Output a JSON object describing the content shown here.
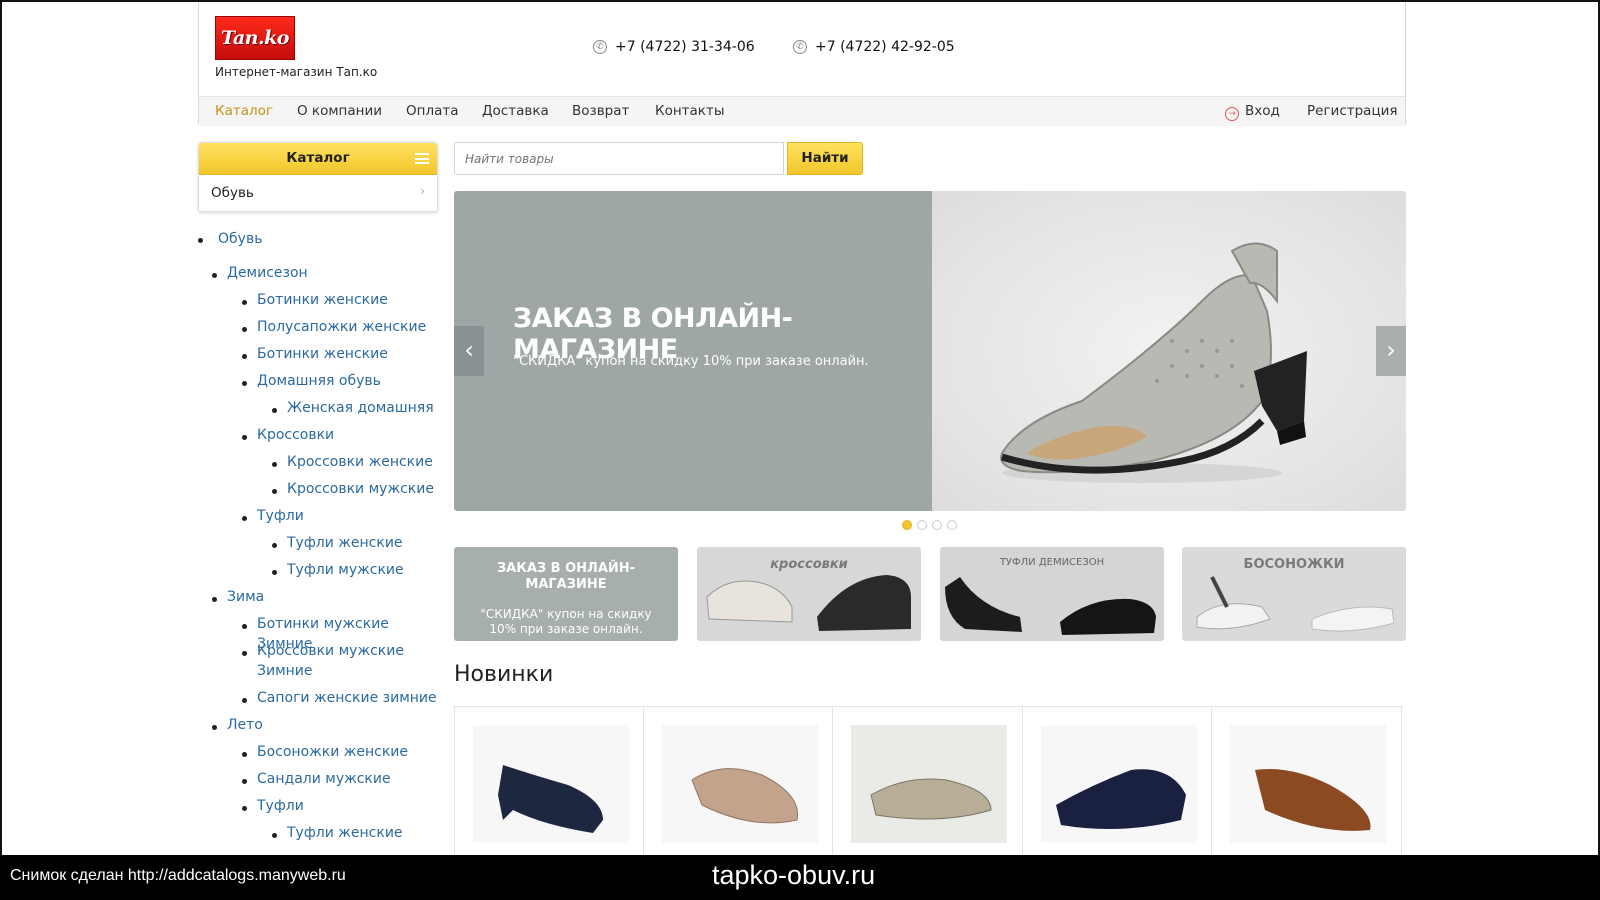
{
  "header": {
    "logo_text": "Tan.ko",
    "logo_subtitle": "Интернет-магазин Тап.ко",
    "phones": [
      "+7 (4722) 31-34-06",
      "+7 (4722) 42-92-05"
    ]
  },
  "nav": {
    "items": [
      "Каталог",
      "О компании",
      "Оплата",
      "Доставка",
      "Возврат",
      "Контакты"
    ],
    "login": "Вход",
    "register": "Регистрация"
  },
  "catalog": {
    "title": "Каталог",
    "row": "Обувь"
  },
  "tree": {
    "root": "Обувь",
    "demiseason": "Демисезон",
    "d1": "Ботинки женские",
    "d2": "Полусапожки женские",
    "d3": "Ботинки женские",
    "d4": "Домашняя обувь",
    "d4a": "Женская домашняя",
    "d5": "Кроссовки",
    "d5a": "Кроссовки женские",
    "d5b": "Кроссовки мужские",
    "d6": "Туфли",
    "d6a": "Туфли женские",
    "d6b": "Туфли мужские",
    "winter": "Зима",
    "w1": "Ботинки мужские Зимние",
    "w2": "Кроссовки мужские Зимние",
    "w3": "Сапоги женские зимние",
    "summer": "Лето",
    "s1": "Босоножки женские",
    "s2": "Сандали мужские",
    "s3": "Туфли",
    "s3a": "Туфли женские"
  },
  "search": {
    "placeholder": "Найти товары",
    "button": "Найти"
  },
  "slider": {
    "title": "ЗАКАЗ В ОНЛАЙН-МАГАЗИНЕ",
    "subtitle": "\"СКИДКА\" купон на скидку 10% при заказе онлайн.",
    "prev": "‹",
    "next": "›",
    "dots": 4,
    "active_dot": 1
  },
  "banners": {
    "b1_title": "ЗАКАЗ В ОНЛАЙН-МАГАЗИНЕ",
    "b1_sub": "\"СКИДКА\" купон на скидку 10% при заказе онлайн.",
    "b2": "кроссовки",
    "b3": "ТУФЛИ ДЕМИСЕЗОН",
    "b4": "БОСОНОЖКИ"
  },
  "section_title": "Новинки",
  "footer": {
    "note": "Снимок сделан http://addcatalogs.manyweb.ru",
    "domain": "tapko-obuv.ru"
  },
  "colors": {
    "accent_yellow": "#f2c62a",
    "link_blue": "#2b6aa0",
    "active_nav": "#c7921a",
    "logo_red": "#d81515"
  }
}
